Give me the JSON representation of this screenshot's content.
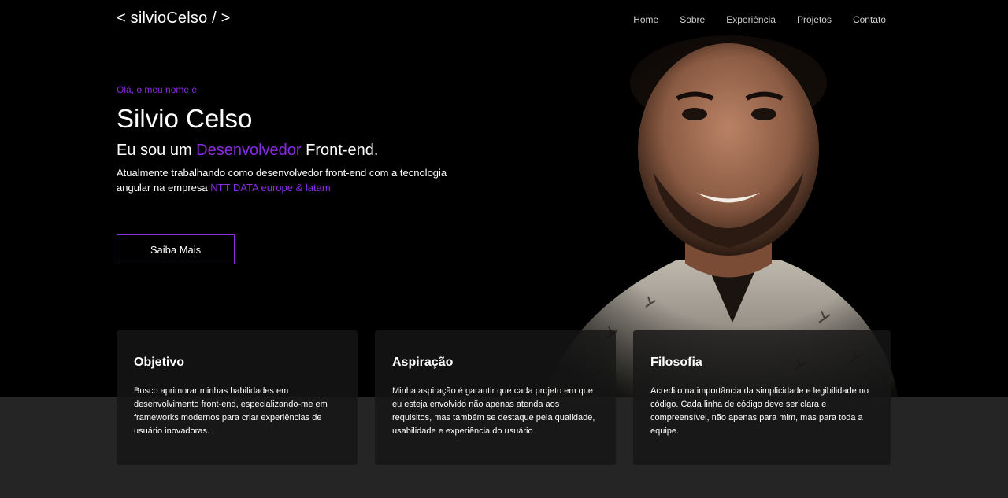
{
  "brand": {
    "logo": "< silvioCelso / >"
  },
  "nav": {
    "items": [
      {
        "label": "Home"
      },
      {
        "label": "Sobre"
      },
      {
        "label": "Experiência"
      },
      {
        "label": "Projetos"
      },
      {
        "label": "Contato"
      }
    ]
  },
  "hero": {
    "greeting": "Olá, o meu nome é",
    "name": "Silvio Celso",
    "role_prefix": "Eu sou um ",
    "role_highlight": "Desenvolvedor",
    "role_suffix": " Front-end.",
    "description_prefix": "Atualmente trabalhando como desenvolvedor front-end com a tecnologia angular na empresa ",
    "description_highlight": "NTT DATA europe & latam",
    "cta_label": "Saiba Mais"
  },
  "cards": [
    {
      "title": "Objetivo",
      "text": "Busco aprimorar minhas habilidades em desenvolvimento front-end, especializando-me em frameworks modernos para criar experiências de usuário inovadoras."
    },
    {
      "title": "Aspiração",
      "text": "Minha aspiração é garantir que cada projeto em que eu esteja envolvido não apenas atenda aos requisitos, mas também se destaque pela qualidade, usabilidade e experiência do usuário"
    },
    {
      "title": "Filosofia",
      "text": "Acredito na importância da simplicidade e legibilidade no código. Cada linha de código deve ser clara e compreensível, não apenas para mim, mas para toda a equipe."
    }
  ],
  "colors": {
    "accent": "#8a2be2",
    "hero_background": "#000000",
    "page_background": "#252525",
    "card_background": "#161616"
  }
}
